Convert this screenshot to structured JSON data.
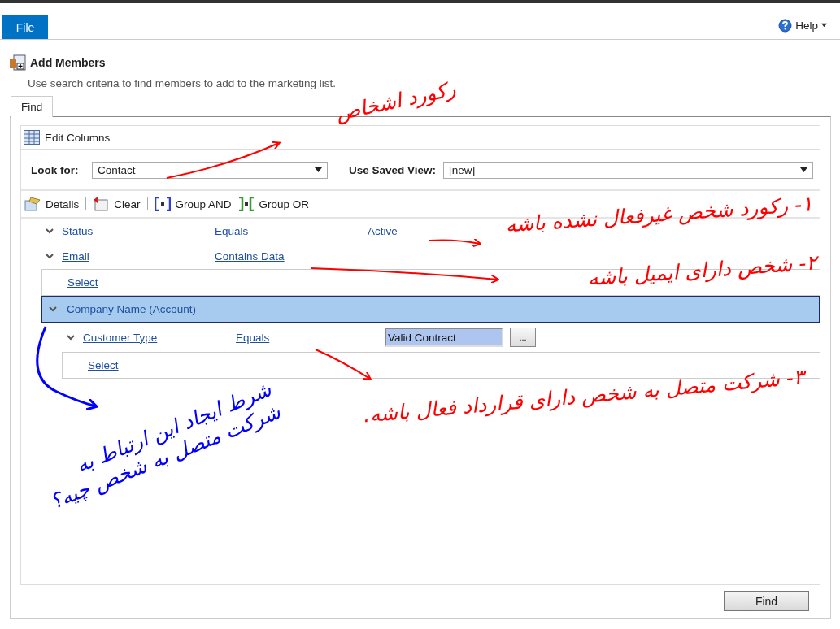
{
  "ribbon": {
    "file_tab": "File",
    "help": "Help"
  },
  "header": {
    "title": "Add Members",
    "subtitle": "Use search criteria to find members to add to the marketing list."
  },
  "tabs": [
    {
      "label": "Find",
      "selected": true
    }
  ],
  "toolbar_top": {
    "edit_columns": "Edit Columns"
  },
  "look_for": {
    "label": "Look for:",
    "value": "Contact"
  },
  "saved_view": {
    "label": "Use Saved View:",
    "value": "[new]"
  },
  "toolbar": [
    {
      "label": "Details",
      "kind": "details"
    },
    {
      "label": "Clear",
      "kind": "clear"
    },
    {
      "label": "Group AND",
      "kind": "and"
    },
    {
      "label": "Group OR",
      "kind": "or"
    }
  ],
  "conditions": [
    {
      "field": "Status",
      "operator": "Equals",
      "value": "Active",
      "expanded": true
    },
    {
      "field": "Email",
      "operator": "Contains Data",
      "expanded": true
    }
  ],
  "select_link": "Select",
  "group": {
    "label": "Company Name (Account)",
    "selected": true,
    "expanded": true,
    "conditions": [
      {
        "field": "Customer Type",
        "operator": "Equals",
        "value_field": "Valid Contract",
        "lookup": "...",
        "expanded": true
      }
    ],
    "select_link": "Select"
  },
  "find_button": "Find",
  "annotations": [
    {
      "text": "رکورد اشخاص",
      "color": "#ff0000"
    },
    {
      "text": "۱- رکورد شخص غیرفعال نشده باشه",
      "color": "#ff0000"
    },
    {
      "text": "۲- شخص دارای ایمیل باشه",
      "color": "#ff0000"
    },
    {
      "text": "۳- شرکت متصل به شخص دارای قرارداد فعال باشه.",
      "color": "#ff0000"
    },
    {
      "text": "شرط ایجاد این ارتباط به شرکت متصل به شخص چیه؟",
      "color": "#0000ff"
    }
  ]
}
